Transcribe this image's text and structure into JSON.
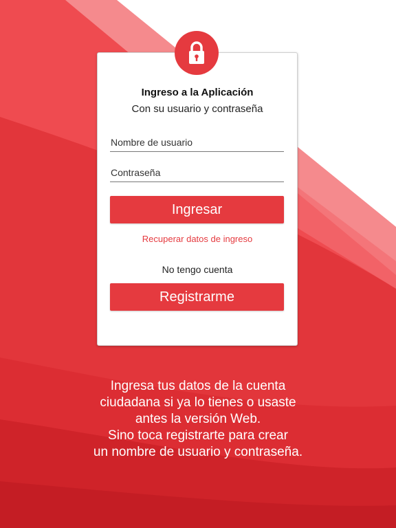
{
  "colors": {
    "accent": "#e53a3f",
    "card_background": "#ffffff",
    "text_on_accent": "#ffffff"
  },
  "header": {
    "lock_icon": "lock-icon",
    "title": "Ingreso a la Aplicación",
    "subtitle": "Con su usuario y contraseña"
  },
  "form": {
    "username_placeholder": "Nombre de usuario",
    "username_value": "",
    "password_placeholder": "Contraseña",
    "password_value": "",
    "login_label": "Ingresar",
    "recover_label": "Recuperar datos de ingreso",
    "no_account_label": "No tengo cuenta",
    "register_label": "Registrarme"
  },
  "info": {
    "lines": [
      "Ingresa tus datos de la cuenta",
      "ciudadana si ya lo tienes o usaste",
      "antes la versión Web.",
      "Sino toca registrarte para crear",
      "un nombre de usuario y contraseña."
    ]
  }
}
